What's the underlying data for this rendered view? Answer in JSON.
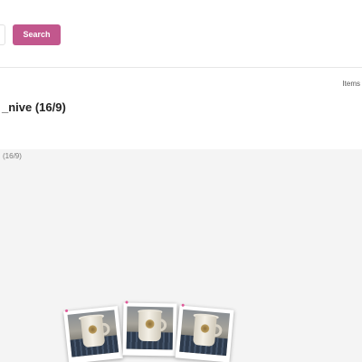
{
  "search": {
    "button_label": "Search",
    "button_color": "#c2578d"
  },
  "header": {
    "items_label": "Items",
    "title": "_nive (16/9)"
  },
  "gallery": {
    "caption": "(16/9)",
    "background": "#f4f4f4",
    "accent_dot_color": "#e05a9a",
    "photos": [
      {
        "subject": "mug on keyboard"
      },
      {
        "subject": "mug on keyboard"
      },
      {
        "subject": "mug on keyboard"
      }
    ]
  }
}
